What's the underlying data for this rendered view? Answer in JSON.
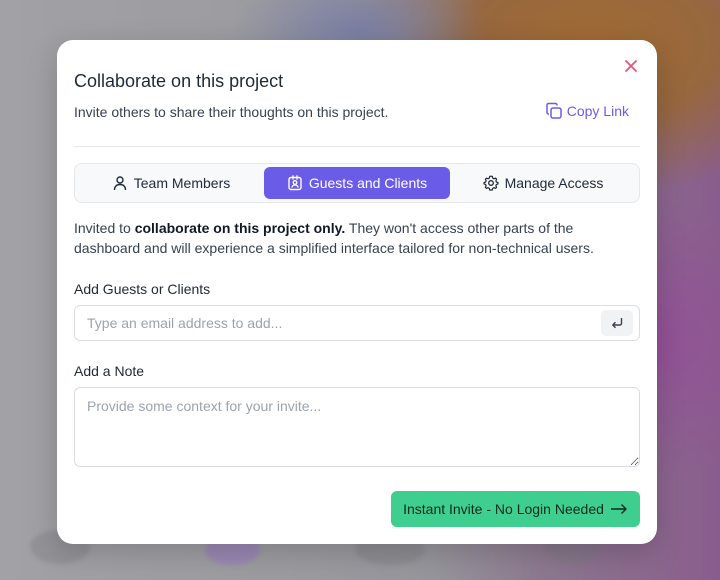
{
  "modal": {
    "title": "Collaborate on this project",
    "subtitle": "Invite others to share their thoughts on this project.",
    "copy_link_label": "Copy Link",
    "close_icon": "close-icon"
  },
  "tabs": [
    {
      "label": "Team Members",
      "icon": "user-icon",
      "active": false
    },
    {
      "label": "Guests and Clients",
      "icon": "contact-badge-icon",
      "active": true
    },
    {
      "label": "Manage Access",
      "icon": "gear-icon",
      "active": false
    }
  ],
  "description": {
    "prefix": "Invited to ",
    "emphasis": "collaborate on this project only.",
    "suffix": " They won't access other parts of the dashboard and will experience a simplified interface tailored for non-technical users."
  },
  "guests": {
    "label": "Add Guests or Clients",
    "placeholder": "Type an email address to add...",
    "value": "",
    "enter_icon": "enter-return-icon"
  },
  "note": {
    "label": "Add a Note",
    "placeholder": "Provide some context for your invite...",
    "value": ""
  },
  "invite_button": {
    "label": "Instant Invite - No Login Needed",
    "icon": "arrow-right-icon"
  },
  "colors": {
    "accent": "#6b5ce7",
    "primary_button": "#3ecf8e",
    "close_icon": "#e8557a"
  }
}
